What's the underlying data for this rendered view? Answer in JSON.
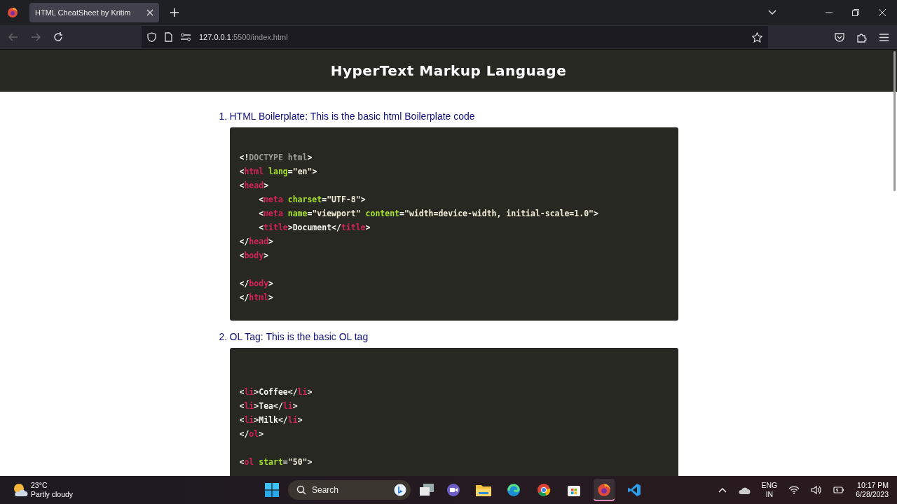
{
  "browser": {
    "tab": {
      "title": "HTML CheatSheet by Kritim",
      "selected": true
    },
    "url_host": "127.0.0.1",
    "url_rest": ":5500/index.html"
  },
  "page": {
    "title": "HyperText Markup Language",
    "sections": [
      {
        "number": "1.",
        "heading": "HTML Boilerplate: This is the basic html Boilerplate code",
        "lines": [
          {
            "kind": "blank"
          },
          {
            "kind": "code",
            "tokens": [
              {
                "kind": "punct",
                "text": "<!"
              },
              {
                "kind": "doctype",
                "text": "DOCTYPE html"
              },
              {
                "kind": "punct",
                "text": ">"
              }
            ]
          },
          {
            "kind": "code",
            "tokens": [
              {
                "kind": "punct",
                "text": "<"
              },
              {
                "kind": "tag",
                "text": "html"
              },
              {
                "kind": "attr",
                "text": " lang"
              },
              {
                "kind": "punct",
                "text": "="
              },
              {
                "kind": "string",
                "text": "\"en\""
              },
              {
                "kind": "punct",
                "text": ">"
              }
            ]
          },
          {
            "kind": "code",
            "tokens": [
              {
                "kind": "punct",
                "text": "<"
              },
              {
                "kind": "tag",
                "text": "head"
              },
              {
                "kind": "punct",
                "text": ">"
              }
            ]
          },
          {
            "kind": "code",
            "tokens": [
              {
                "kind": "punct",
                "text": "    <"
              },
              {
                "kind": "tag",
                "text": "meta"
              },
              {
                "kind": "attr",
                "text": " charset"
              },
              {
                "kind": "punct",
                "text": "="
              },
              {
                "kind": "string",
                "text": "\"UTF-8\""
              },
              {
                "kind": "punct",
                "text": ">"
              }
            ]
          },
          {
            "kind": "code",
            "tokens": [
              {
                "kind": "punct",
                "text": "    <"
              },
              {
                "kind": "tag",
                "text": "meta"
              },
              {
                "kind": "attr",
                "text": " name"
              },
              {
                "kind": "punct",
                "text": "="
              },
              {
                "kind": "string",
                "text": "\"viewport\""
              },
              {
                "kind": "attr",
                "text": " content"
              },
              {
                "kind": "punct",
                "text": "="
              },
              {
                "kind": "string",
                "text": "\"width=device-width, initial-scale=1.0\""
              },
              {
                "kind": "punct",
                "text": ">"
              }
            ]
          },
          {
            "kind": "code",
            "tokens": [
              {
                "kind": "punct",
                "text": "    <"
              },
              {
                "kind": "tag",
                "text": "title"
              },
              {
                "kind": "punct",
                "text": ">Document</"
              },
              {
                "kind": "tag",
                "text": "title"
              },
              {
                "kind": "punct",
                "text": ">"
              }
            ]
          },
          {
            "kind": "code",
            "tokens": [
              {
                "kind": "punct",
                "text": "</"
              },
              {
                "kind": "tag",
                "text": "head"
              },
              {
                "kind": "punct",
                "text": ">"
              }
            ]
          },
          {
            "kind": "code",
            "tokens": [
              {
                "kind": "punct",
                "text": "<"
              },
              {
                "kind": "tag",
                "text": "body"
              },
              {
                "kind": "punct",
                "text": ">"
              }
            ]
          },
          {
            "kind": "blank"
          },
          {
            "kind": "code",
            "tokens": [
              {
                "kind": "punct",
                "text": "</"
              },
              {
                "kind": "tag",
                "text": "body"
              },
              {
                "kind": "punct",
                "text": ">"
              }
            ]
          },
          {
            "kind": "code",
            "tokens": [
              {
                "kind": "punct",
                "text": "</"
              },
              {
                "kind": "tag",
                "text": "html"
              },
              {
                "kind": "punct",
                "text": ">"
              }
            ]
          }
        ]
      },
      {
        "number": "2.",
        "heading": "OL Tag: This is the basic OL tag",
        "lines": [
          {
            "kind": "blank"
          },
          {
            "kind": "blank"
          },
          {
            "kind": "code",
            "tokens": [
              {
                "kind": "punct",
                "text": "<"
              },
              {
                "kind": "tag",
                "text": "li"
              },
              {
                "kind": "punct",
                "text": ">Coffee</"
              },
              {
                "kind": "tag",
                "text": "li"
              },
              {
                "kind": "punct",
                "text": ">"
              }
            ]
          },
          {
            "kind": "code",
            "tokens": [
              {
                "kind": "punct",
                "text": "<"
              },
              {
                "kind": "tag",
                "text": "li"
              },
              {
                "kind": "punct",
                "text": ">Tea</"
              },
              {
                "kind": "tag",
                "text": "li"
              },
              {
                "kind": "punct",
                "text": ">"
              }
            ]
          },
          {
            "kind": "code",
            "tokens": [
              {
                "kind": "punct",
                "text": "<"
              },
              {
                "kind": "tag",
                "text": "li"
              },
              {
                "kind": "punct",
                "text": ">Milk</"
              },
              {
                "kind": "tag",
                "text": "li"
              },
              {
                "kind": "punct",
                "text": ">"
              }
            ]
          },
          {
            "kind": "code",
            "tokens": [
              {
                "kind": "punct",
                "text": "</"
              },
              {
                "kind": "tag",
                "text": "ol"
              },
              {
                "kind": "punct",
                "text": ">"
              }
            ]
          },
          {
            "kind": "blank"
          },
          {
            "kind": "code",
            "tokens": [
              {
                "kind": "punct",
                "text": "<"
              },
              {
                "kind": "tag",
                "text": "ol"
              },
              {
                "kind": "attr",
                "text": " start"
              },
              {
                "kind": "punct",
                "text": "="
              },
              {
                "kind": "string",
                "text": "\"50\""
              },
              {
                "kind": "punct",
                "text": ">"
              }
            ]
          }
        ]
      }
    ]
  },
  "taskbar": {
    "weather": {
      "temperature": "23°C",
      "condition": "Partly cloudy"
    },
    "search": {
      "placeholder": "Search"
    },
    "apps": [
      {
        "kind": "meet",
        "selected": false
      },
      {
        "kind": "folder",
        "selected": false
      },
      {
        "kind": "edge",
        "selected": false
      },
      {
        "kind": "chrome",
        "selected": false
      },
      {
        "kind": "store",
        "selected": false
      },
      {
        "kind": "firefox",
        "selected": true
      },
      {
        "kind": "vscode",
        "selected": false
      }
    ],
    "language": "ENG",
    "region": "IN",
    "time": "10:17 PM",
    "date": "6/28/2023"
  }
}
